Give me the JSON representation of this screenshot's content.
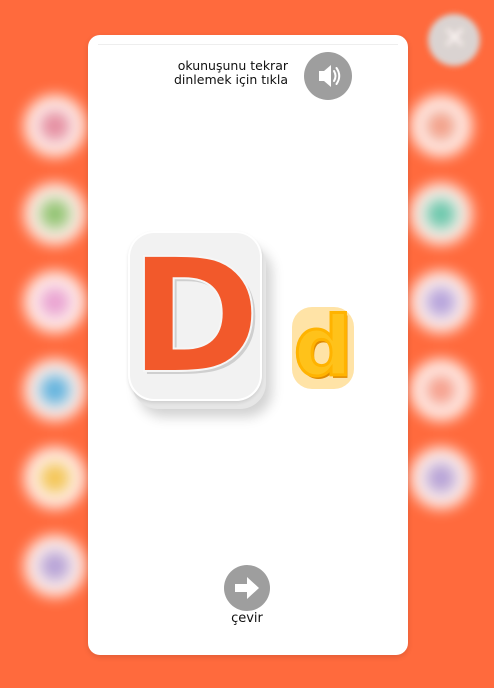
{
  "colors": {
    "background": "#ff6a3d",
    "uppercase_letter": "#f2592b",
    "lowercase_letter": "#ffc21a",
    "button_gray": "#9e9e9e"
  },
  "background_blobs": [
    {
      "name": "bg-blob-left-1",
      "color": "#e08aa6"
    },
    {
      "name": "bg-blob-left-2",
      "color": "#7ecb6f"
    },
    {
      "name": "bg-blob-left-3",
      "color": "#e6a3e0"
    },
    {
      "name": "bg-blob-left-4",
      "color": "#45b7ef"
    },
    {
      "name": "bg-blob-left-5",
      "color": "#f2cd4d"
    },
    {
      "name": "bg-blob-left-6",
      "color": "#a9a3e6"
    },
    {
      "name": "bg-blob-right-1",
      "color": "#f0a08a"
    },
    {
      "name": "bg-blob-right-2",
      "color": "#4fcfb3"
    },
    {
      "name": "bg-blob-right-3",
      "color": "#a8a4ec"
    },
    {
      "name": "bg-blob-right-4",
      "color": "#f5a08f"
    },
    {
      "name": "bg-blob-right-5",
      "color": "#a9a3e6"
    }
  ],
  "close_button": {
    "icon": "close-icon",
    "glyph": "✕"
  },
  "card": {
    "hint_line_1": "okunuşunu tekrar",
    "hint_line_2": "dinlemek için tıkla",
    "sound_button": {
      "icon": "speaker-icon"
    },
    "uppercase_letter": "D",
    "lowercase_letter": "d",
    "flip_button": {
      "icon": "arrow-right-icon"
    },
    "flip_label": "çevir"
  }
}
